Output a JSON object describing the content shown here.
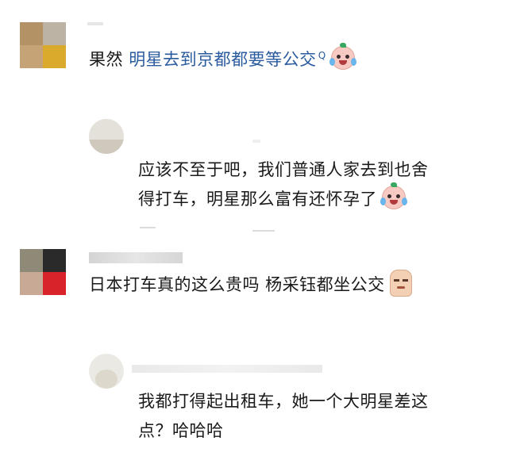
{
  "comments": [
    {
      "prefix": "果然 ",
      "link_text": "明星去到京都都要等公交",
      "search_mark": "Q",
      "emoji": "crying-laughing-emoji"
    },
    {
      "line1": "应该不至于吧，我们普通人家去到也舍",
      "line2": "得打车，明星那么富有还怀孕了",
      "emoji": "crying-laughing-emoji"
    },
    {
      "text": "日本打车真的这么贵吗 杨采钰都坐公交",
      "emoji": "smirk-emoji"
    },
    {
      "line1": "我都打得起出租车，她一个大明星差这",
      "line2": "点？哈哈哈"
    }
  ],
  "colors": {
    "link": "#2a5b9e",
    "text": "#1a1a1a",
    "background": "#ffffff"
  }
}
